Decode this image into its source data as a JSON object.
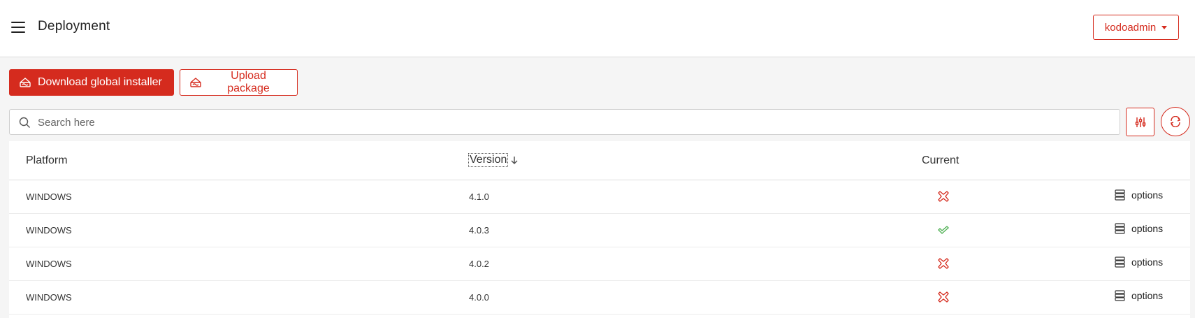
{
  "header": {
    "title": "Deployment",
    "user_menu_label": "kodoadmin"
  },
  "actions": {
    "download_label": "Download global installer",
    "upload_label": "Upload package"
  },
  "search": {
    "placeholder": "Search here",
    "value": ""
  },
  "table": {
    "columns": {
      "platform": "Platform",
      "version": "Version",
      "current": "Current"
    },
    "sort": {
      "column": "version",
      "direction": "descending"
    },
    "rows": [
      {
        "platform": "WINDOWS",
        "version": "4.1.0",
        "current": false,
        "options_label": "options"
      },
      {
        "platform": "WINDOWS",
        "version": "4.0.3",
        "current": true,
        "options_label": "options"
      },
      {
        "platform": "WINDOWS",
        "version": "4.0.2",
        "current": false,
        "options_label": "options"
      },
      {
        "platform": "WINDOWS",
        "version": "4.0.0",
        "current": false,
        "options_label": "options"
      }
    ]
  },
  "icons": {
    "menu": "hamburger-menu-icon",
    "download": "cake-download-icon",
    "upload": "cake-upload-icon",
    "search": "search-icon",
    "filter": "sliders-filter-icon",
    "refresh": "refresh-icon",
    "current_true": "check-icon",
    "current_false": "x-cross-icon",
    "options": "server-stack-icon",
    "sort": "arrow-down-icon"
  },
  "colors": {
    "accent": "#d52b1e",
    "success": "#4caf50",
    "background": "#f5f5f5"
  }
}
